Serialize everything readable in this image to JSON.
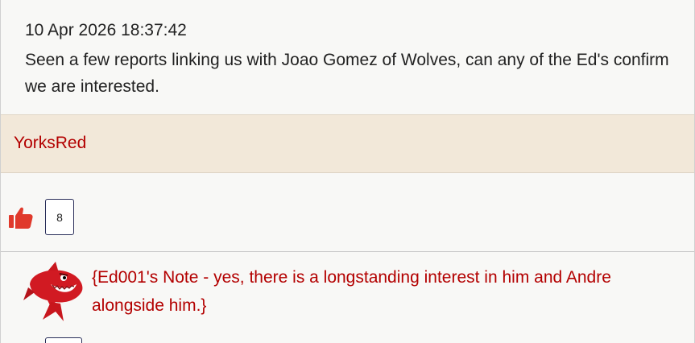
{
  "post": {
    "timestamp": "10 Apr 2026 18:37:42",
    "text": "Seen a few reports linking us with Joao Gomez of Wolves, can any of the Ed's confirm we are interested."
  },
  "author": {
    "name": "YorksRed"
  },
  "likes": {
    "icon": "thumbs-up-icon",
    "count": "8"
  },
  "ed_note": {
    "avatar_icon": "shark-icon",
    "text": "{Ed001's Note - yes, there is a longstanding interest in him and Andre alongside him.}"
  },
  "colors": {
    "accent_red": "#b30000",
    "author_bar": "#f2e8d9",
    "thumb_red": "#e0392b"
  }
}
